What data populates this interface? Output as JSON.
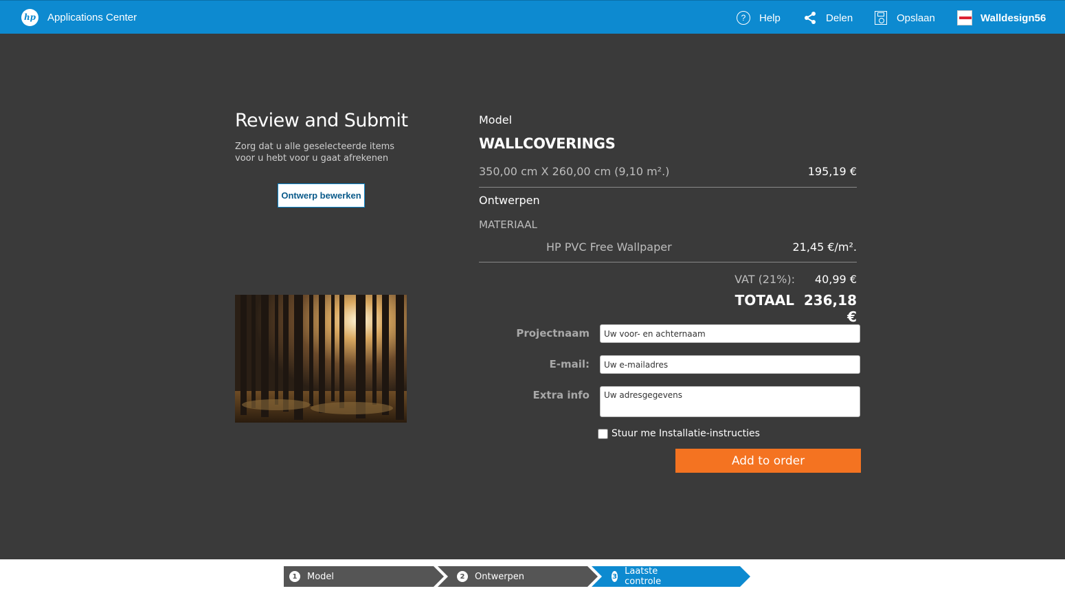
{
  "header": {
    "app_title": "Applications Center",
    "help": "Help",
    "share": "Delen",
    "save": "Opslaan",
    "user": "Walldesign56",
    "accent_color": "#0d8ad0"
  },
  "left": {
    "title": "Review and Submit",
    "subtitle": "Zorg dat u alle geselecteerde items voor u hebt voor u gaat afrekenen",
    "edit_button": "Ontwerp bewerken"
  },
  "summary": {
    "model_label": "Model",
    "product": "WALLCOVERINGS",
    "dimensions": "350,00 cm  X  260,00 cm (9,10 m².)",
    "dimensions_price": "195,19 €",
    "design_label": "Ontwerpen",
    "material_label": "MATERIAAL",
    "material_name": "HP PVC Free Wallpaper",
    "material_price": "21,45 €/m².",
    "vat_label": "VAT  (21%):",
    "vat_value": "40,99 €",
    "total_label": "TOTAAL",
    "total_value": "236,18 €"
  },
  "form": {
    "project_label": "Projectnaam",
    "project_placeholder": "Uw voor- en achternaam",
    "email_label": "E-mail:",
    "email_placeholder": "Uw e-mailadres",
    "extra_label": "Extra info",
    "extra_placeholder": "Uw adresgegevens",
    "checkbox_label": "Stuur me Installatie-instructies",
    "submit": "Add to order",
    "submit_color": "#f47321"
  },
  "steps": [
    {
      "num": "1",
      "label": "Model"
    },
    {
      "num": "2",
      "label": "Ontwerpen"
    },
    {
      "num": "3",
      "label": "Laatste controle"
    }
  ]
}
